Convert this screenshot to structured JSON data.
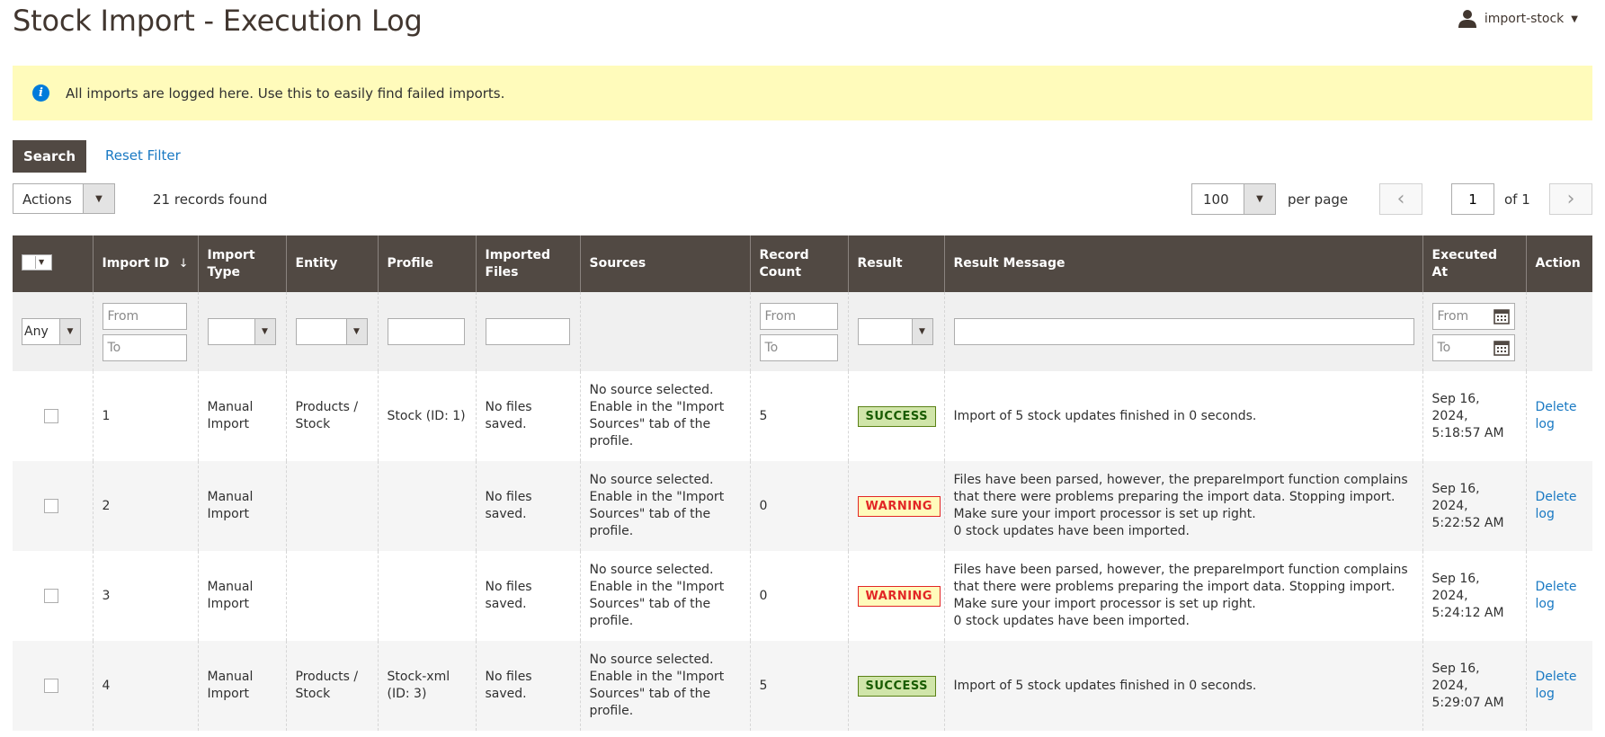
{
  "page": {
    "title": "Stock Import - Execution Log"
  },
  "user": {
    "name": "import-stock"
  },
  "notice": {
    "text": "All imports are logged here. Use this to easily find failed imports."
  },
  "toolbar": {
    "search_label": "Search",
    "reset_label": "Reset Filter",
    "actions_label": "Actions",
    "records_found": "21 records found",
    "per_page_value": "100",
    "per_page_label": "per page",
    "current_page": "1",
    "of_pages": "of 1"
  },
  "columns": {
    "import_id": "Import ID",
    "import_type": "Import Type",
    "entity": "Entity",
    "profile": "Profile",
    "imported_files": "Imported Files",
    "sources": "Sources",
    "record_count": "Record Count",
    "result": "Result",
    "result_message": "Result Message",
    "executed_at": "Executed At",
    "action": "Action"
  },
  "filters": {
    "any": "Any",
    "from": "From",
    "to": "To"
  },
  "rows": [
    {
      "id": "1",
      "type": "Manual Import",
      "entity": "Products / Stock",
      "profile": "Stock (ID: 1)",
      "files": "No files saved.",
      "sources": "No source selected. Enable in the \"Import Sources\" tab of the profile.",
      "count": "5",
      "result": "SUCCESS",
      "message": "Import of 5 stock updates finished in 0 seconds.",
      "executed": "Sep 16, 2024, 5:18:57 AM",
      "action": "Delete log"
    },
    {
      "id": "2",
      "type": "Manual Import",
      "entity": "",
      "profile": "",
      "files": "No files saved.",
      "sources": "No source selected. Enable in the \"Import Sources\" tab of the profile.",
      "count": "0",
      "result": "WARNING",
      "message": "Files have been parsed, however, the prepareImport function complains that there were problems preparing the import data. Stopping import. Make sure your import processor is set up right.",
      "message2": "0 stock updates have been imported.",
      "executed": "Sep 16, 2024, 5:22:52 AM",
      "action": "Delete log"
    },
    {
      "id": "3",
      "type": "Manual Import",
      "entity": "",
      "profile": "",
      "files": "No files saved.",
      "sources": "No source selected. Enable in the \"Import Sources\" tab of the profile.",
      "count": "0",
      "result": "WARNING",
      "message": "Files have been parsed, however, the prepareImport function complains that there were problems preparing the import data. Stopping import. Make sure your import processor is set up right.",
      "message2": "0 stock updates have been imported.",
      "executed": "Sep 16, 2024, 5:24:12 AM",
      "action": "Delete log"
    },
    {
      "id": "4",
      "type": "Manual Import",
      "entity": "Products / Stock",
      "profile": "Stock-xml (ID: 3)",
      "files": "No files saved.",
      "sources": "No source selected. Enable in the \"Import Sources\" tab of the profile.",
      "count": "5",
      "result": "SUCCESS",
      "message": "Import of 5 stock updates finished in 0 seconds.",
      "executed": "Sep 16, 2024, 5:29:07 AM",
      "action": "Delete log"
    }
  ],
  "colors": {
    "header_bg": "#514943",
    "notice_bg": "#fffbbb",
    "link": "#1979c3",
    "success_bg": "#d0e5a9",
    "warning_text": "#e22626"
  }
}
